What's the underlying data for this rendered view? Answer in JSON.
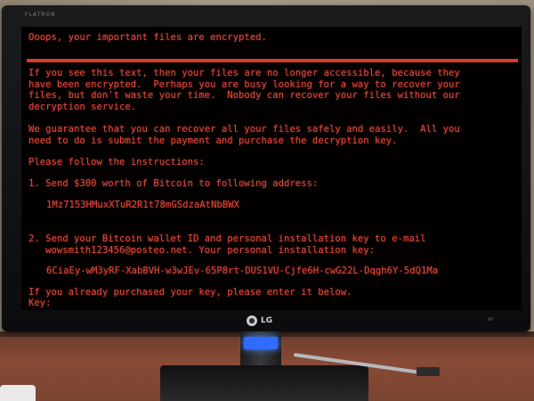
{
  "monitor": {
    "brand_label": "FLATRON",
    "logo_text": "LG",
    "logo_icon": "lg-logo-icon"
  },
  "screen": {
    "headline": "Ooops, your important files are encrypted.",
    "paragraph1": [
      "If you see this text, then your files are no longer accessible, because they",
      "have been encrypted.  Perhaps you are busy looking for a way to recover your",
      "files, but don't waste your time.  Nobody can recover your files without our",
      "decryption service."
    ],
    "paragraph2": [
      "We guarantee that you can recover all your files safely and easily.  All you",
      "need to do is submit the payment and purchase the decryption key."
    ],
    "instructions_intro": "Please follow the instructions:",
    "step1": "1. Send $300 worth of Bitcoin to following address:",
    "bitcoin_address": "1Mz7153HMuxXTuR2R1t78mGSdzaAtNbBWX",
    "step2": [
      "2. Send your Bitcoin wallet ID and personal installation key to e-mail",
      "   wowsmith123456@posteo.net. Your personal installation key:"
    ],
    "installation_key": "6CiaEy-wM3yRF-XabBVH-w3wJEv-65P8rt-DUS1VU-Cjfe6H-cwG22L-Dqgh6Y-5dQ1Ma",
    "footer_prompt": "If you already purchased your key, please enter it below.",
    "key_prompt": "Key:"
  },
  "colors": {
    "text": "#e24a3c",
    "screen_bg": "#030000",
    "rule": "#d33c30"
  }
}
